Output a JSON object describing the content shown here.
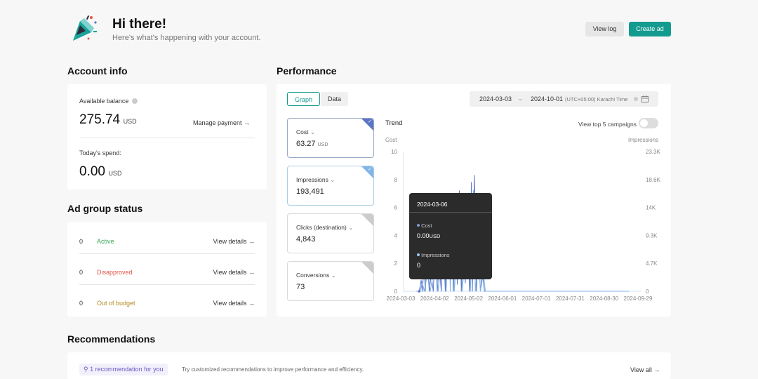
{
  "header": {
    "title": "Hi there!",
    "subtitle": "Here's what's happening with your account.",
    "view_log": "View log",
    "create_ad": "Create ad"
  },
  "account": {
    "heading": "Account info",
    "balance_label": "Available balance",
    "balance_value": "275.74",
    "balance_unit": "USD",
    "manage_payment": "Manage payment",
    "spend_label": "Today's spend:",
    "spend_value": "0.00",
    "spend_unit": "USD"
  },
  "ad_group": {
    "heading": "Ad group status",
    "rows": [
      {
        "count": "0",
        "label": "Active",
        "color": "#3aa757",
        "link": "View details"
      },
      {
        "count": "0",
        "label": "Disapproved",
        "color": "#e0564d",
        "link": "View details"
      },
      {
        "count": "0",
        "label": "Out of budget",
        "color": "#b38a1f",
        "link": "View details"
      }
    ]
  },
  "performance": {
    "heading": "Performance",
    "tab_graph": "Graph",
    "tab_data": "Data",
    "date_start": "2024-03-03",
    "date_sep": "~",
    "date_end": "2024-10-01",
    "timezone": "(UTC+05:00) Karachi Time",
    "metrics": [
      {
        "label": "Cost",
        "value": "63.27",
        "unit": "USD",
        "corner_color": "#5b74c6"
      },
      {
        "label": "Impressions",
        "value": "193,491",
        "unit": "",
        "corner_color": "#82b6e8"
      },
      {
        "label": "Clicks (destination)",
        "value": "4,843",
        "unit": "",
        "corner_color": "#cccccc"
      },
      {
        "label": "Conversions",
        "value": "73",
        "unit": "",
        "corner_color": "#cccccc"
      }
    ],
    "trend_label": "Trend",
    "top5_label": "View top 5 campaigns",
    "left_axis_title": "Cost",
    "right_axis_title": "Impressions",
    "tooltip": {
      "date": "2024-03-06",
      "cost_label": "Cost",
      "cost_value": "0.00",
      "cost_unit": "USD",
      "impr_label": "Impressions",
      "impr_value": "0"
    }
  },
  "recommendations": {
    "heading": "Recommendations",
    "badge": "1 recommendation for you",
    "text": "Try customized recommendations to improve performance and efficiency.",
    "view_all": "View all"
  },
  "chart_data": {
    "type": "line",
    "title": "Trend",
    "x_ticks": [
      "2024-03-03",
      "2024-04-02",
      "2024-05-02",
      "2024-06-01",
      "2024-07-01",
      "2024-07-31",
      "2024-08-30",
      "2024-09-29"
    ],
    "y_left_ticks": [
      "0",
      "2",
      "4",
      "6",
      "8",
      "10"
    ],
    "y_right_ticks": [
      "0",
      "4.7K",
      "9.3K",
      "14K",
      "18.6K",
      "23.3K"
    ],
    "ylim_left": [
      0,
      10
    ],
    "ylabel_left": "Cost",
    "ylabel_right": "Impressions",
    "series": [
      {
        "name": "Cost",
        "color": "#5b74c6",
        "points": [
          [
            0,
            0
          ],
          [
            3,
            0
          ],
          [
            5,
            0.8
          ],
          [
            6,
            0
          ],
          [
            8,
            1.8
          ],
          [
            9,
            0
          ],
          [
            11,
            2.6
          ],
          [
            13,
            0
          ],
          [
            15,
            1.2
          ],
          [
            17,
            0
          ],
          [
            19,
            3.4
          ],
          [
            21,
            0
          ],
          [
            23,
            2.0
          ],
          [
            25,
            0
          ],
          [
            27,
            4.5
          ],
          [
            29,
            0
          ],
          [
            31,
            6.0
          ],
          [
            33,
            1.0
          ],
          [
            35,
            6.8
          ],
          [
            37,
            0
          ],
          [
            39,
            5.2
          ],
          [
            41,
            0.5
          ],
          [
            43,
            7.2
          ],
          [
            45,
            0
          ],
          [
            47,
            5.5
          ],
          [
            49,
            0.6
          ],
          [
            51,
            6.4
          ],
          [
            53,
            0
          ],
          [
            55,
            7.8
          ],
          [
            56,
            0
          ],
          [
            58,
            8.3
          ],
          [
            60,
            0
          ],
          [
            62,
            3.0
          ],
          [
            64,
            0
          ],
          [
            66,
            1.5
          ],
          [
            68,
            0
          ],
          [
            70,
            0
          ],
          [
            212,
            0
          ]
        ]
      },
      {
        "name": "Impressions",
        "color": "#82b6e8",
        "points": [
          [
            0,
            0
          ],
          [
            4,
            0
          ],
          [
            6,
            1600
          ],
          [
            8,
            0
          ],
          [
            12,
            3500
          ],
          [
            14,
            0
          ],
          [
            20,
            6000
          ],
          [
            22,
            0
          ],
          [
            28,
            9500
          ],
          [
            30,
            0
          ],
          [
            32,
            12000
          ],
          [
            34,
            0
          ],
          [
            36,
            14500
          ],
          [
            38,
            0
          ],
          [
            44,
            15500
          ],
          [
            46,
            0
          ],
          [
            52,
            14000
          ],
          [
            54,
            0
          ],
          [
            57,
            16800
          ],
          [
            59,
            0
          ],
          [
            62,
            6500
          ],
          [
            64,
            0
          ],
          [
            67,
            3000
          ],
          [
            69,
            0
          ],
          [
            212,
            0
          ]
        ]
      }
    ]
  }
}
